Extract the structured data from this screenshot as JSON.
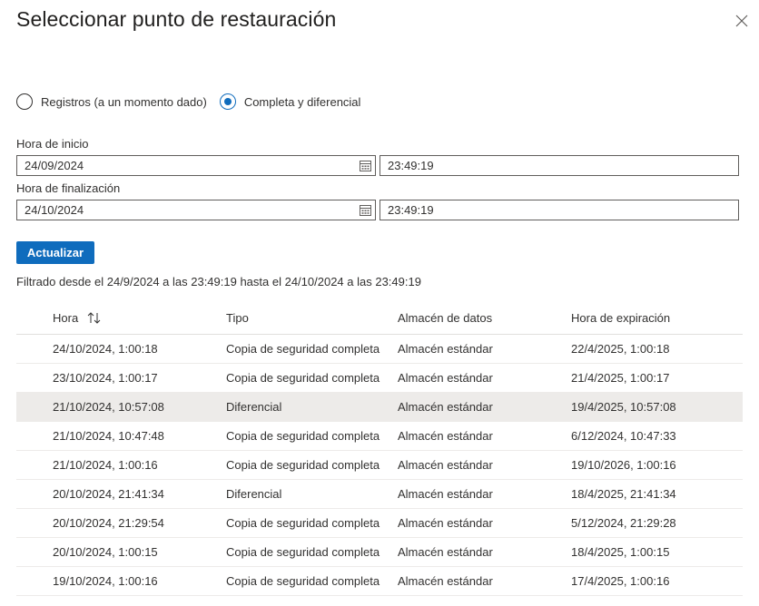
{
  "dialog": {
    "title": "Seleccionar punto de restauración",
    "close_icon": "close-icon"
  },
  "restore_type": {
    "options": [
      {
        "label": "Registros (a un momento dado)",
        "selected": false
      },
      {
        "label": "Completa y diferencial",
        "selected": true
      }
    ]
  },
  "start": {
    "label": "Hora de inicio",
    "date": "24/09/2024",
    "time": "23:49:19",
    "icon": "calendar-icon"
  },
  "end": {
    "label": "Hora de finalización",
    "date": "24/10/2024",
    "time": "23:49:19",
    "icon": "calendar-icon"
  },
  "refresh_button": "Actualizar",
  "filter_text": "Filtrado desde el 24/9/2024 a las 23:49:19 hasta el 24/10/2024 a las 23:49:19",
  "table": {
    "headers": [
      "Hora",
      "Tipo",
      "Almacén de datos",
      "Hora de expiración"
    ],
    "sort_icon": "sort-arrows-icon",
    "selected_row": 2,
    "rows": [
      [
        "24/10/2024, 1:00:18",
        "Copia de seguridad completa",
        "Almacén estándar",
        "22/4/2025, 1:00:18"
      ],
      [
        "23/10/2024, 1:00:17",
        "Copia de seguridad completa",
        "Almacén estándar",
        "21/4/2025, 1:00:17"
      ],
      [
        "21/10/2024, 10:57:08",
        "Diferencial",
        "Almacén estándar",
        "19/4/2025, 10:57:08"
      ],
      [
        "21/10/2024, 10:47:48",
        "Copia de seguridad completa",
        "Almacén estándar",
        "6/12/2024, 10:47:33"
      ],
      [
        "21/10/2024, 1:00:16",
        "Copia de seguridad completa",
        "Almacén estándar",
        "19/10/2026, 1:00:16"
      ],
      [
        "20/10/2024, 21:41:34",
        "Diferencial",
        "Almacén estándar",
        "18/4/2025, 21:41:34"
      ],
      [
        "20/10/2024, 21:29:54",
        "Copia de seguridad completa",
        "Almacén estándar",
        "5/12/2024, 21:29:28"
      ],
      [
        "20/10/2024, 1:00:15",
        "Copia de seguridad completa",
        "Almacén estándar",
        "18/4/2025, 1:00:15"
      ],
      [
        "19/10/2024, 1:00:16",
        "Copia de seguridad completa",
        "Almacén estándar",
        "17/4/2025, 1:00:16"
      ]
    ]
  },
  "colors": {
    "accent": "#0f6cbd",
    "selected_row": "#edebe9"
  }
}
